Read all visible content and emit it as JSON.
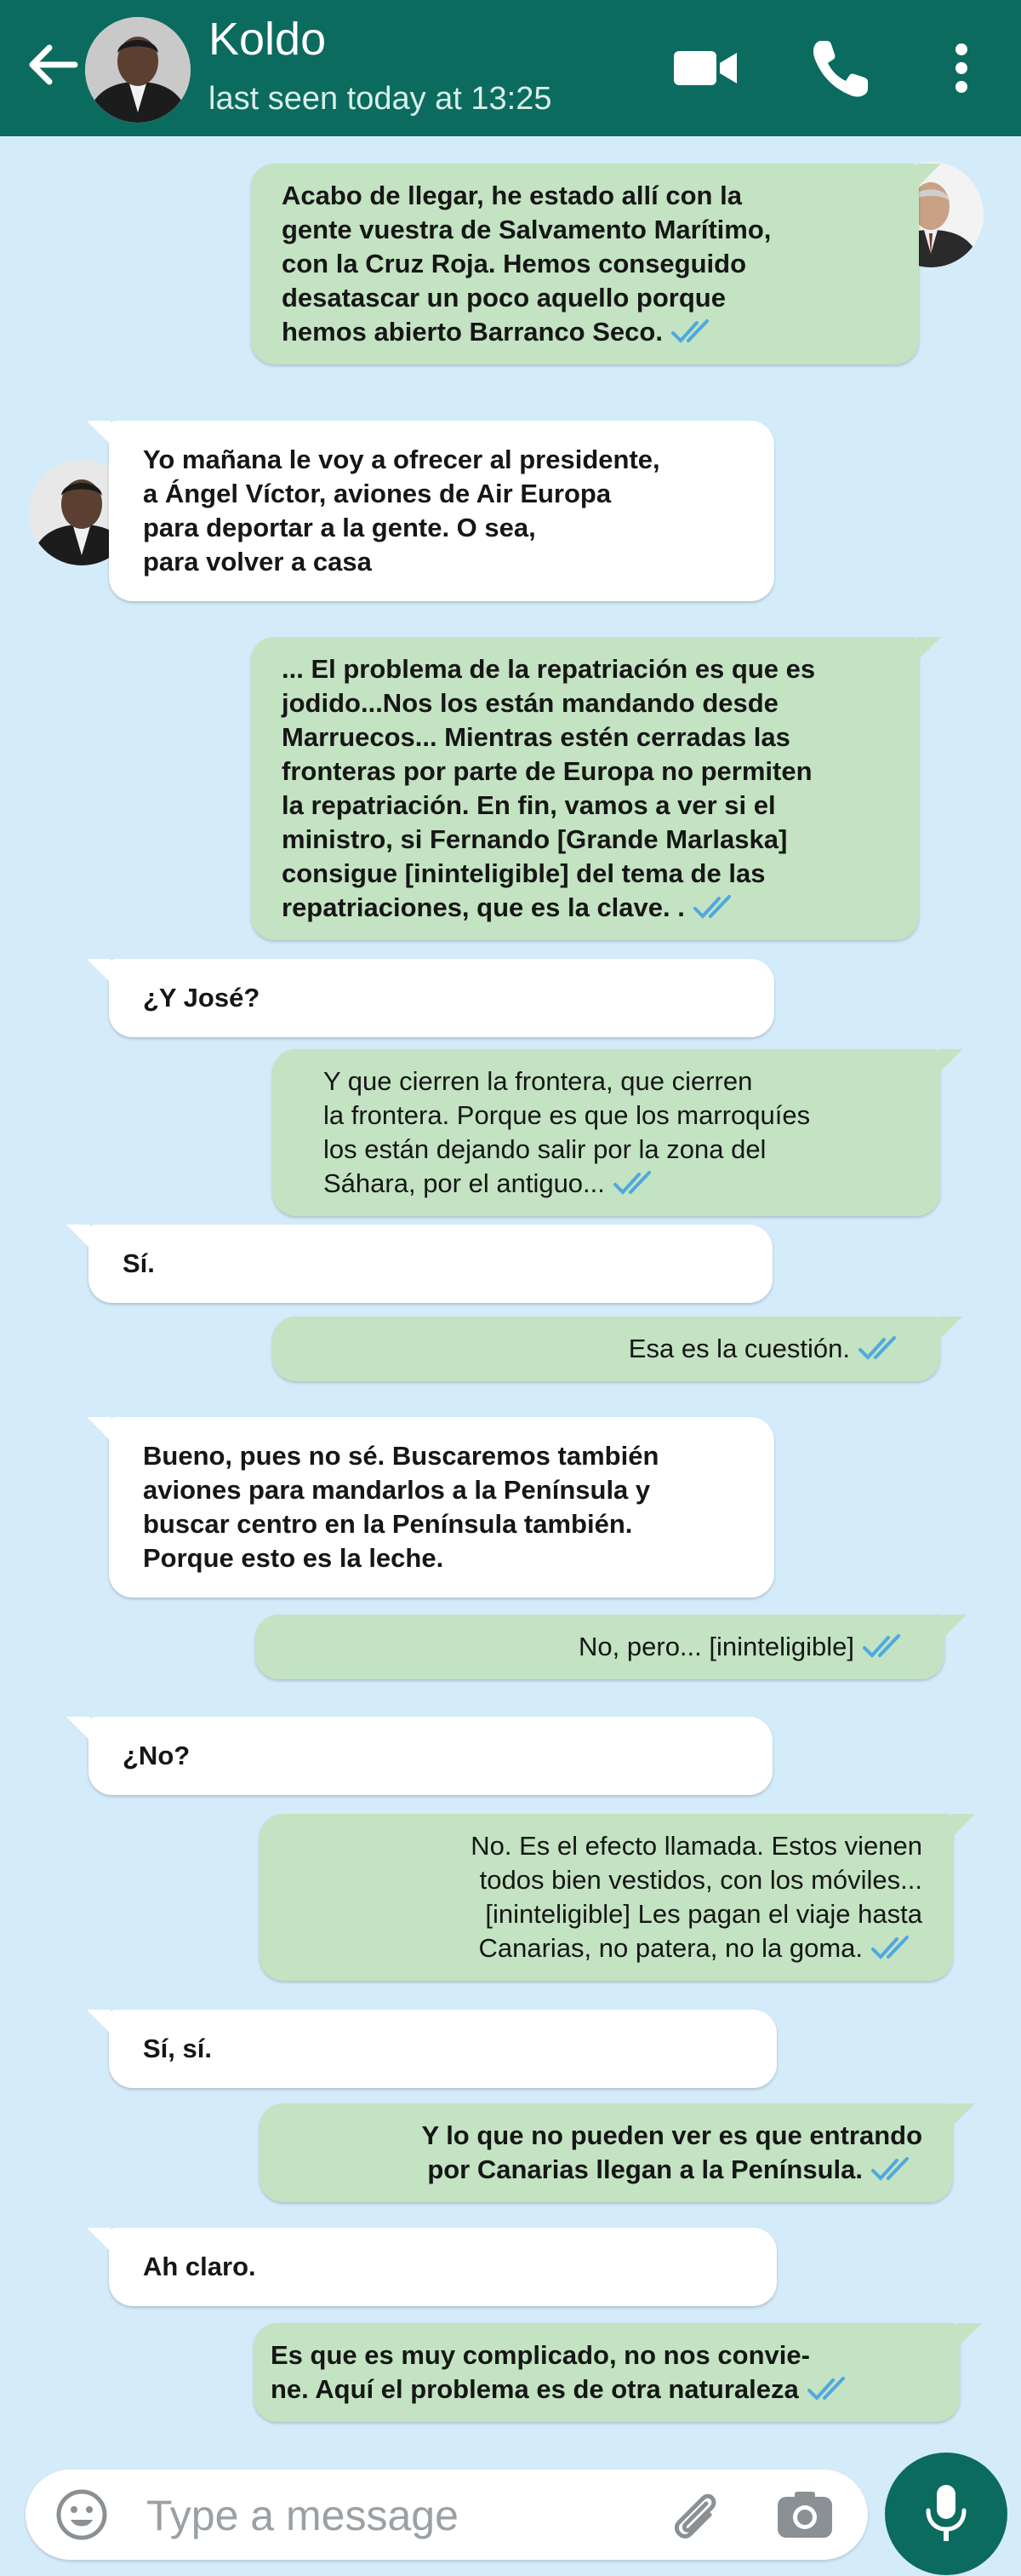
{
  "header": {
    "contact_name": "Koldo",
    "last_seen": "last seen today at 13:25",
    "back_icon": "arrow-left-icon",
    "video_icon": "video-camera-icon",
    "call_icon": "phone-icon",
    "menu_icon": "more-vertical-icon"
  },
  "messages": [
    {
      "direction": "outgoing",
      "text": "Acabo de llegar, he estado allí con la\ngente vuestra de Salvamento Marítimo,\ncon la Cruz Roja. Hemos conseguido\ndesatascar un poco aquello porque\nhemos abierto Barranco Seco.",
      "read": true
    },
    {
      "direction": "incoming",
      "text": "Yo mañana le voy a ofrecer al presidente,\na Ángel Víctor, aviones de Air Europa\npara deportar a la gente. O sea,\npara volver a casa"
    },
    {
      "direction": "outgoing",
      "text": "... El problema de la repatriación es que es\njodido...Nos los están mandando desde\nMarruecos... Mientras estén cerradas las\nfronteras por parte de Europa no permiten\nla repatriación. En fin, vamos a ver si el\nministro, si Fernando [Grande Marlaska]\nconsigue [ininteligible] del tema de las\nrepatriaciones, que es la clave. .",
      "read": true
    },
    {
      "direction": "incoming",
      "text": "¿Y José?"
    },
    {
      "direction": "outgoing",
      "text": "Y que cierren la frontera, que cierren\nla frontera. Porque es que los marroquíes\nlos están dejando salir por la zona del\nSáhara, por el antiguo...",
      "read": true
    },
    {
      "direction": "incoming",
      "text": "Sí."
    },
    {
      "direction": "outgoing",
      "text": "Esa es la cuestión.",
      "read": true
    },
    {
      "direction": "incoming",
      "text": "Bueno, pues no sé. Buscaremos también\naviones para mandarlos a la Península y\nbuscar centro en la Península también.\nPorque esto es la leche."
    },
    {
      "direction": "outgoing",
      "text": "No, pero... [ininteligible]",
      "read": true
    },
    {
      "direction": "incoming",
      "text": "¿No?"
    },
    {
      "direction": "outgoing",
      "text": "No. Es el efecto llamada. Estos vienen\ntodos bien vestidos, con los móviles...\n[ininteligible] Les pagan el viaje hasta\nCanarias, no patera, no la goma.",
      "read": true
    },
    {
      "direction": "incoming",
      "text": "Sí, sí."
    },
    {
      "direction": "outgoing",
      "text": "Y lo que no pueden ver es que entrando\npor Canarias llegan a la Península.",
      "read": true
    },
    {
      "direction": "incoming",
      "text": "Ah claro."
    },
    {
      "direction": "outgoing",
      "text": "Es que es muy complicado, no nos convie-\nne. Aquí el problema es de otra naturaleza",
      "read": true
    }
  ],
  "input": {
    "placeholder": "Type a message",
    "emoji_icon": "emoji-icon",
    "attach_icon": "paperclip-icon",
    "camera_icon": "camera-icon",
    "mic_icon": "microphone-icon"
  },
  "colors": {
    "header": "#0b6b5e",
    "chat_background": "#d4ebf9",
    "outgoing_bubble": "#c3e3c2",
    "incoming_bubble": "#ffffff",
    "read_ticks": "#4fa8e0"
  }
}
